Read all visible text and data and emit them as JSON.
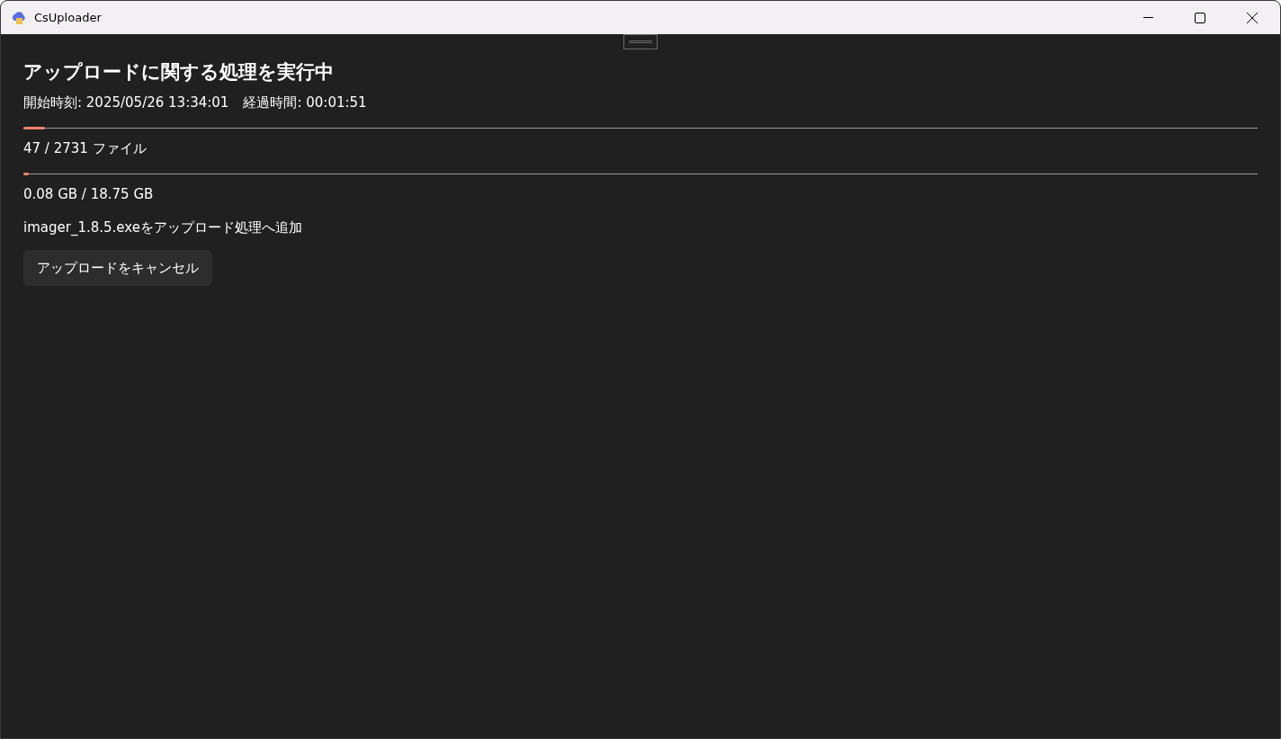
{
  "window": {
    "title": "CsUploader"
  },
  "heading": "アップロードに関する処理を実行中",
  "timing": {
    "start": "開始時刻: 2025/05/26 13:34:01",
    "elapsed": "経過時間: 00:01:51"
  },
  "progress": [
    {
      "level": 0.0172,
      "reading": "47 / 2731 ファイル"
    },
    {
      "level": 0.0043,
      "reading": "0.08 GB / 18.75 GB"
    }
  ],
  "status": "imager_1.8.5.exeをアップロード処理へ追加",
  "buttons": [
    "アップロードをキャンセル"
  ]
}
